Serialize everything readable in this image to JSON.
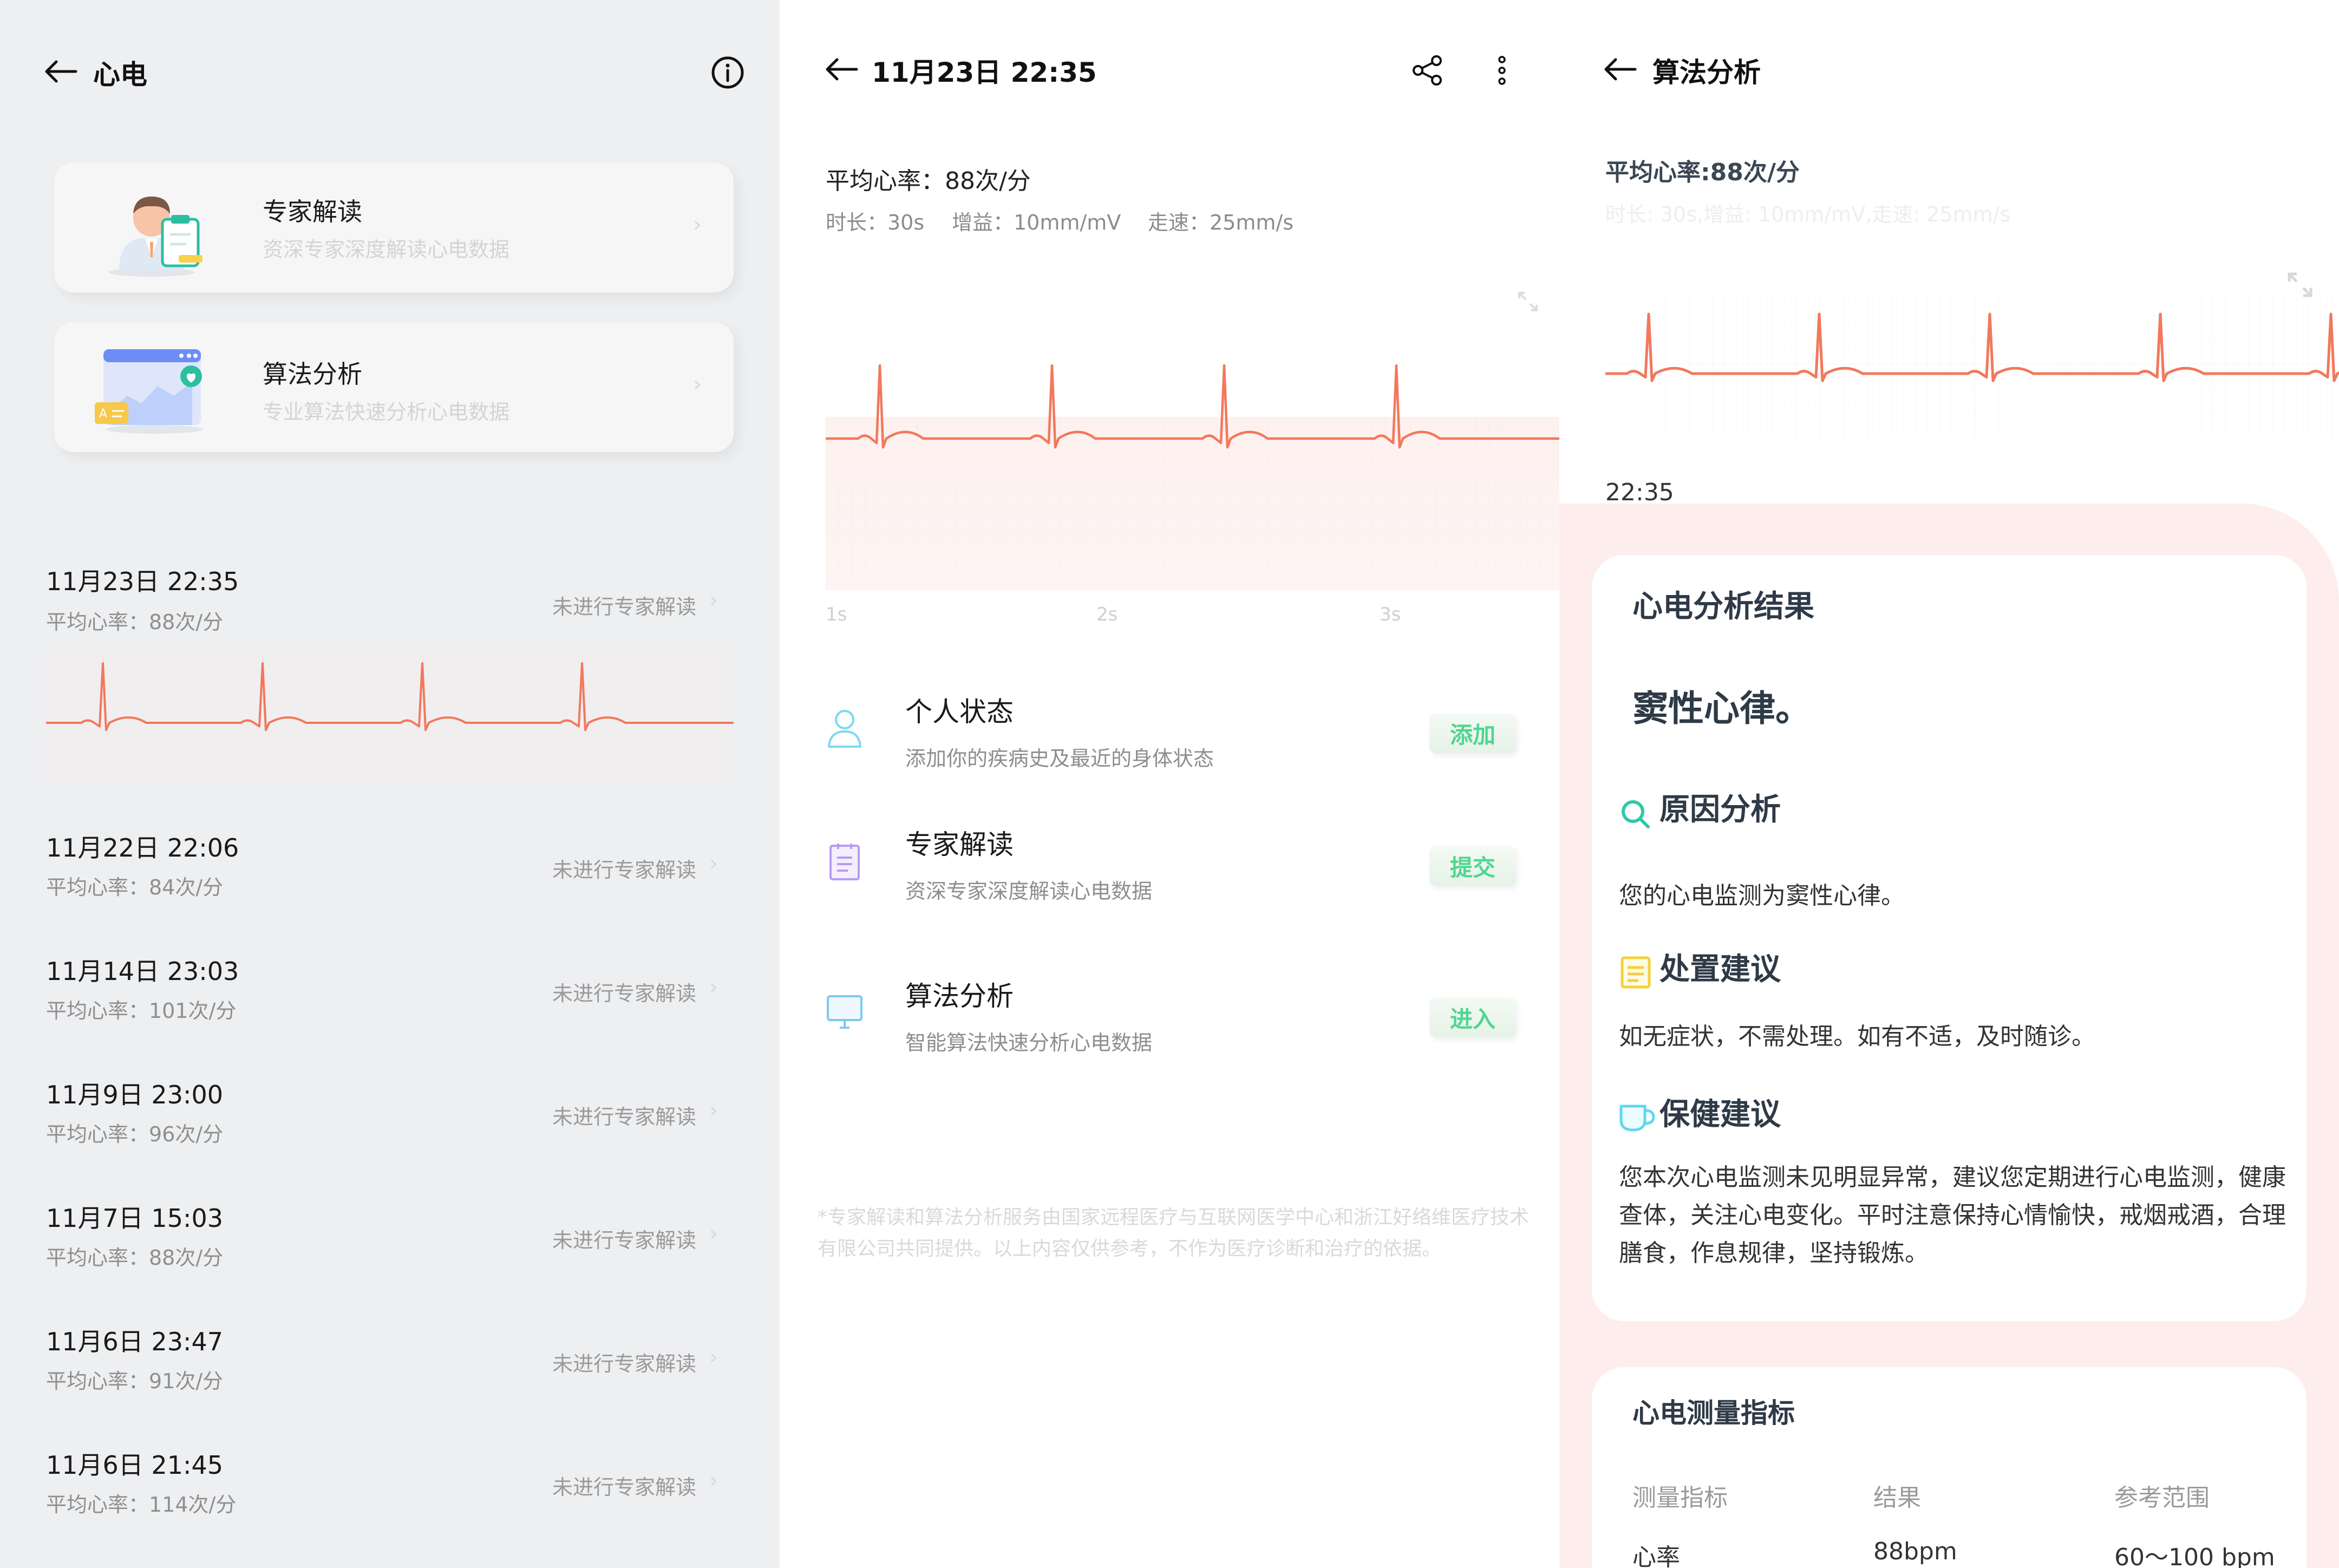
{
  "list_screen": {
    "title": "心电",
    "cards": [
      {
        "title": "专家解读",
        "subtitle": "资深专家深度解读心电数据"
      },
      {
        "title": "算法分析",
        "subtitle": "专业算法快速分析心电数据"
      }
    ],
    "records": [
      {
        "date": "11月23日 22:35",
        "hr": "平均心率：88次/分",
        "status": "未进行专家解读"
      },
      {
        "date": "11月22日 22:06",
        "hr": "平均心率：84次/分",
        "status": "未进行专家解读"
      },
      {
        "date": "11月14日 23:03",
        "hr": "平均心率：101次/分",
        "status": "未进行专家解读"
      },
      {
        "date": "11月9日 23:00",
        "hr": "平均心率：96次/分",
        "status": "未进行专家解读"
      },
      {
        "date": "11月7日 15:03",
        "hr": "平均心率：88次/分",
        "status": "未进行专家解读"
      },
      {
        "date": "11月6日 23:47",
        "hr": "平均心率：91次/分",
        "status": "未进行专家解读"
      },
      {
        "date": "11月6日 21:45",
        "hr": "平均心率：114次/分",
        "status": "未进行专家解读"
      }
    ]
  },
  "detail_screen": {
    "title": "11月23日 22:35",
    "avg_hr": "平均心率：88次/分",
    "duration": "时长：30s",
    "gain": "增益：10mm/mV",
    "speed": "走速：25mm/s",
    "axis_labels": [
      "1s",
      "2s",
      "3s"
    ],
    "actions": [
      {
        "title": "个人状态",
        "subtitle": "添加你的疾病史及最近的身体状态",
        "button": "添加",
        "icon": "person-icon"
      },
      {
        "title": "专家解读",
        "subtitle": "资深专家深度解读心电数据",
        "button": "提交",
        "icon": "clipboard-icon"
      },
      {
        "title": "算法分析",
        "subtitle": "智能算法快速分析心电数据",
        "button": "进入",
        "icon": "monitor-icon"
      }
    ],
    "disclaimer": "*专家解读和算法分析服务由国家远程医疗与互联网医学中心和浙江好络维医疗技术有限公司共同提供。以上内容仅供参考，不作为医疗诊断和治疗的依据。"
  },
  "analysis_screen": {
    "title": "算法分析",
    "avg_hr": "平均心率:88次/分",
    "meta": "时长: 30s,增益: 10mm/mV,走速: 25mm/s",
    "time": "22:35",
    "result_heading": "心电分析结果",
    "result": "窦性心律。",
    "cause_heading": "原因分析",
    "cause_text": "您的心电监测为窦性心律。",
    "advice_heading": "处置建议",
    "advice_text": "如无症状，不需处理。如有不适，及时随诊。",
    "health_heading": "保健建议",
    "health_text": "您本次心电监测未见明显异常，建议您定期进行心电监测，健康查体，关注心电变化。平时注意保持心情愉快，戒烟戒酒，合理膳食，作息规律，坚持锻炼。",
    "metrics_heading": "心电测量指标",
    "table_headers": [
      "测量指标",
      "结果",
      "参考范围"
    ],
    "table_rows": [
      [
        "心率",
        "88bpm",
        "60～100 bpm"
      ]
    ]
  },
  "colors": {
    "ecg_line": "#f2785c",
    "accent_green": "#4fd68f",
    "heading_dark": "#2e3a47"
  }
}
